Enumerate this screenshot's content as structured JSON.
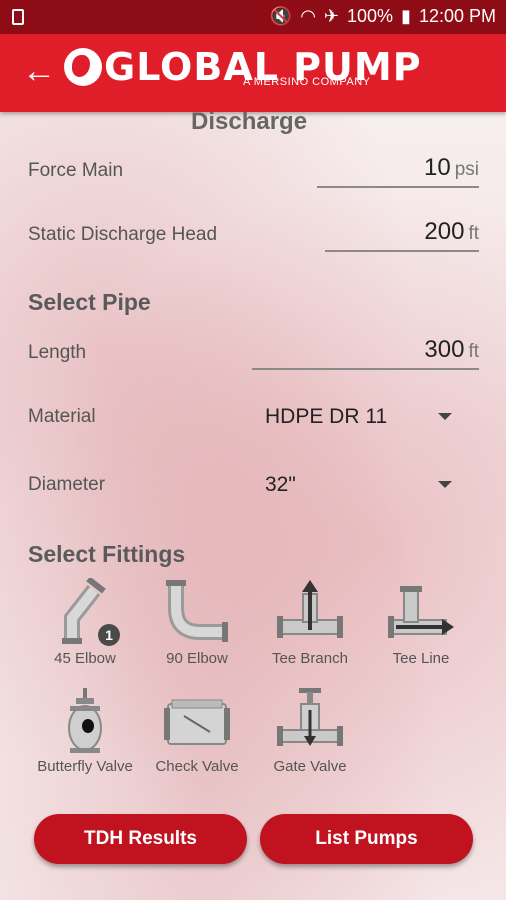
{
  "status": {
    "battery": "100%",
    "time": "12:00 PM"
  },
  "header": {
    "brand": "GLOBAL PUMP",
    "tagline": "A MERSINO COMPANY"
  },
  "section_peek": "Discharge",
  "discharge": {
    "force_main_label": "Force Main",
    "force_main_value": "10",
    "force_main_unit": "psi",
    "static_head_label": "Static Discharge Head",
    "static_head_value": "200",
    "static_head_unit": "ft"
  },
  "pipe": {
    "title": "Select Pipe",
    "length_label": "Length",
    "length_value": "300",
    "length_unit": "ft",
    "material_label": "Material",
    "material_value": "HDPE DR 11",
    "diameter_label": "Diameter",
    "diameter_value": "32\""
  },
  "fittings": {
    "title": "Select Fittings",
    "items": [
      {
        "label": "45 Elbow",
        "icon": "45-elbow-icon",
        "count": "1"
      },
      {
        "label": "90 Elbow",
        "icon": "90-elbow-icon"
      },
      {
        "label": "Tee Branch",
        "icon": "tee-branch-icon"
      },
      {
        "label": "Tee Line",
        "icon": "tee-line-icon"
      },
      {
        "label": "Butterfly Valve",
        "icon": "butterfly-valve-icon"
      },
      {
        "label": "Check Valve",
        "icon": "check-valve-icon"
      },
      {
        "label": "Gate Valve",
        "icon": "gate-valve-icon"
      }
    ]
  },
  "actions": {
    "tdh_label": "TDH Results",
    "list_label": "List Pumps"
  },
  "colors": {
    "status_bar": "#8e0c16",
    "app_bar": "#e01e2a",
    "button": "#c1121f"
  }
}
